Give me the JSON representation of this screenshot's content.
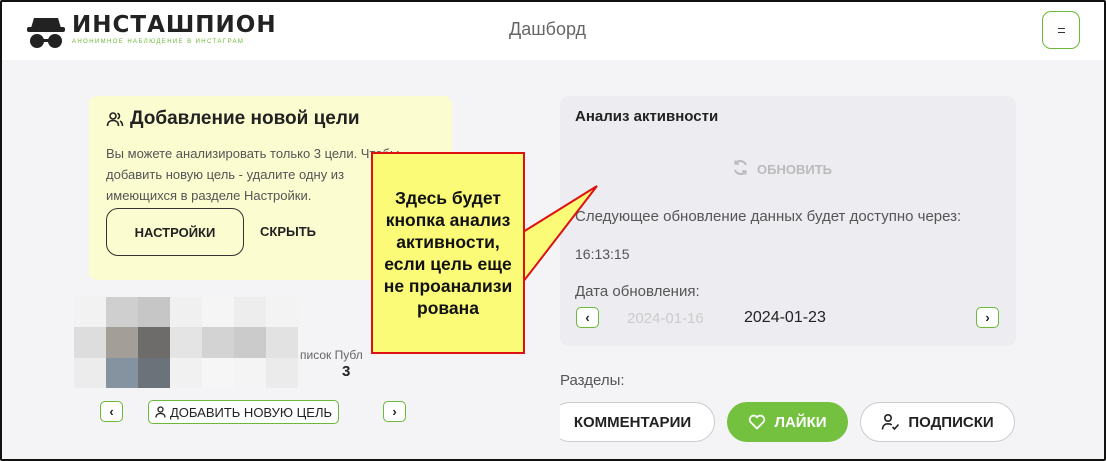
{
  "header": {
    "logo_title": "ИНСТАШПИОН",
    "logo_subtitle": "АНОНИМНОЕ НАБЛЮДЕНИЕ В ИНСТАГРАМ",
    "nav_title": "Дашборд",
    "menu_icon": "hamburger-icon"
  },
  "add_target_card": {
    "title": "Добавление новой цели",
    "title_icon": "users-icon",
    "text": "Вы можете анализировать только 3 цели. Чтобы добавить новую цель - удалите одну из имеющихся в разделе Настройки.",
    "settings_button": "НАСТРОЙКИ",
    "hide_button": "СКРЫТЬ",
    "background": "#fbfcd0"
  },
  "profile": {
    "stat_labels": "писок   Публ",
    "stat_value": "3",
    "prev_icon": "chevron-left-icon",
    "next_icon": "chevron-right-icon",
    "add_target_label": "ДОБАВИТЬ НОВУЮ ЦЕЛЬ",
    "add_target_icon": "user-icon"
  },
  "activity": {
    "title": "Анализ активности",
    "refresh_label": "ОБНОВИТЬ",
    "refresh_icon": "refresh-icon",
    "next_update_text": "Следующее обновление данных будет доступно через:",
    "timer": "16:13:15",
    "date_label": "Дата обновления:",
    "date_prev": "2024-01-16",
    "date_current": "2024-01-23"
  },
  "sections": {
    "label": "Разделы:",
    "tabs": [
      {
        "label": "КОММЕНТАРИИ",
        "active": false
      },
      {
        "label": "ЛАЙКИ",
        "active": true,
        "icon": "heart-icon"
      },
      {
        "label": "ПОДПИСКИ",
        "active": false,
        "icon": "user-check-icon"
      }
    ]
  },
  "callout": {
    "text": "Здесь будет кнопка анализ активности, если цель еще не проанализи рована",
    "border_color": "#dd1111",
    "background": "#fbfb77"
  },
  "colors": {
    "accent": "#74c13f",
    "accent_border": "#6cb83a"
  }
}
